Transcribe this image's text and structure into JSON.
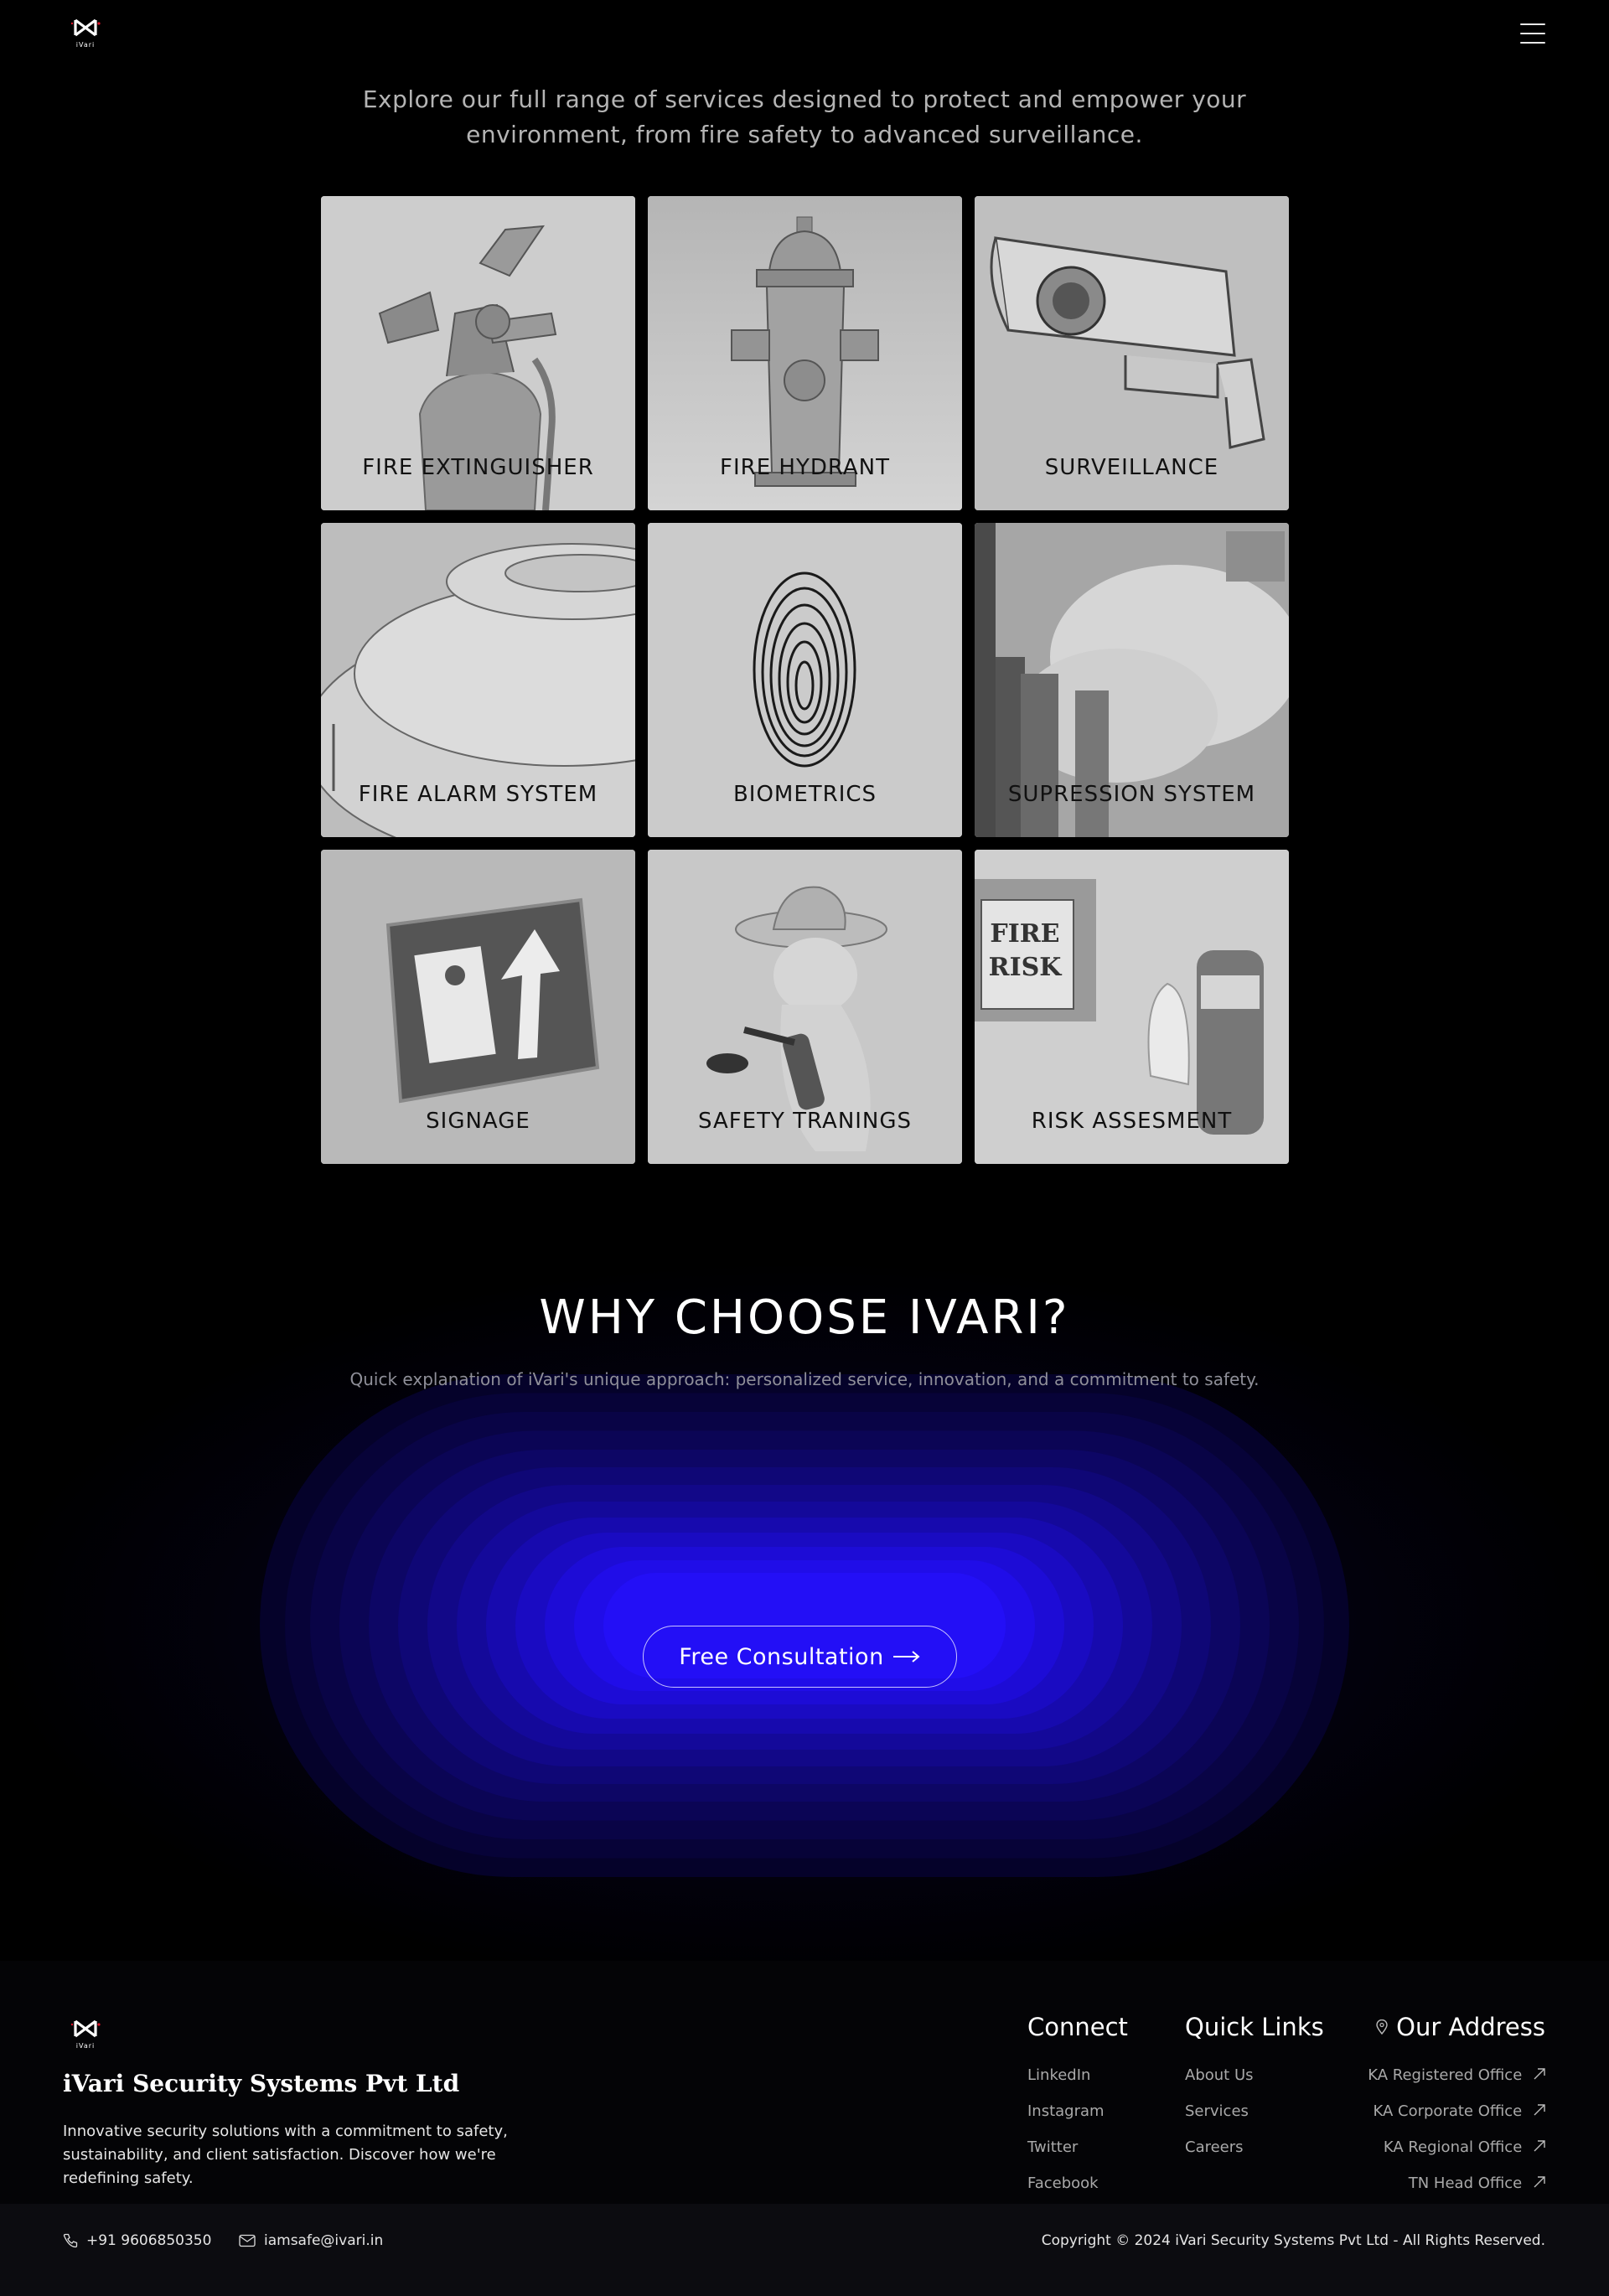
{
  "header": {
    "logo_text": "iVari",
    "menu_icon": "hamburger-menu-icon"
  },
  "intro": {
    "text": "Explore our full range of services designed to protect and empower your environment, from fire safety to advanced surveillance."
  },
  "services": [
    {
      "label": "FIRE EXTINGUISHER",
      "icon": "fire-extinguisher-image"
    },
    {
      "label": "FIRE HYDRANT",
      "icon": "fire-hydrant-image"
    },
    {
      "label": "SURVEILLANCE",
      "icon": "cctv-camera-image"
    },
    {
      "label": "FIRE ALARM SYSTEM",
      "icon": "smoke-detector-image"
    },
    {
      "label": "BIOMETRICS",
      "icon": "fingerprint-image"
    },
    {
      "label": "SUPRESSION SYSTEM",
      "icon": "suppression-system-image"
    },
    {
      "label": "SIGNAGE",
      "icon": "exit-sign-image"
    },
    {
      "label": "SAFETY TRANINGS",
      "icon": "safety-training-image"
    },
    {
      "label": "RISK ASSESMENT",
      "icon": "risk-assessment-image"
    }
  ],
  "why": {
    "title": "WHY CHOOSE IVARI?",
    "subtitle": "Quick explanation of iVari's unique approach: personalized service, innovation, and a commitment to safety.",
    "cta_label": "Free Consultation"
  },
  "footer": {
    "logo_text": "iVari",
    "company": "iVari Security Systems Pvt Ltd",
    "tagline": "Innovative security solutions with a commitment to safety, sustainability, and client satisfaction. Discover how we're redefining safety.",
    "connect": {
      "title": "Connect",
      "links": [
        "LinkedIn",
        "Instagram",
        "Twitter",
        "Facebook"
      ]
    },
    "quick_links": {
      "title": "Quick Links",
      "links": [
        "About Us",
        "Services",
        "Careers"
      ]
    },
    "address": {
      "title": "Our Address",
      "links": [
        "KA Registered Office",
        "KA Corporate Office",
        "KA Regional Office",
        "TN Head Office"
      ]
    },
    "phone": "+91 9606850350",
    "email": "iamsafe@ivari.in",
    "copyright": "Copyright © 2024 iVari Security Systems Pvt Ltd - All Rights Reserved."
  },
  "colors": {
    "accent": "#2a10ff",
    "page_bg": "#000000",
    "footer_bg": "#0c0c10"
  }
}
